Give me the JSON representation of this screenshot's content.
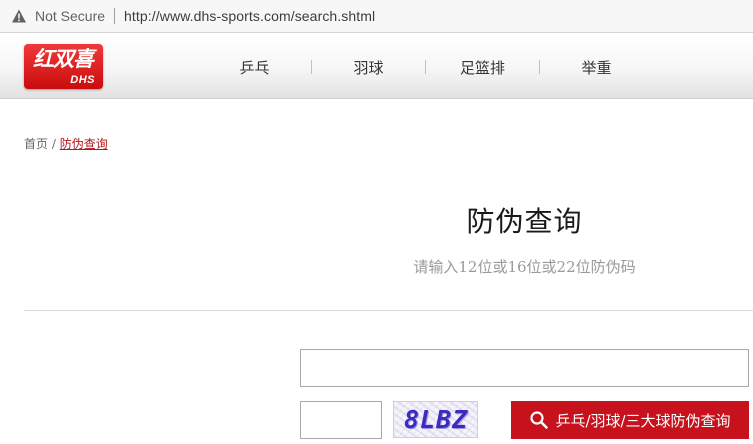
{
  "browser": {
    "security_label": "Not Secure",
    "url": "http://www.dhs-sports.com/search.shtml"
  },
  "header": {
    "logo_text": "红双喜",
    "logo_sub": "DHS",
    "brand_color": "#c90d0d",
    "nav": [
      {
        "label": "乒乓"
      },
      {
        "label": "羽球"
      },
      {
        "label": "足篮排"
      },
      {
        "label": "举重"
      }
    ]
  },
  "breadcrumb": {
    "home": "首页",
    "separator": " / ",
    "current": "防伪查询"
  },
  "main": {
    "title": "防伪查询",
    "subtitle": "请输入12位或16位或22位防伪码",
    "code_input_value": "",
    "captcha_input_value": "",
    "captcha_text": "8LBZ",
    "search_button_label": "乒乓/羽球/三大球防伪查询",
    "accent_color": "#c7111c"
  }
}
